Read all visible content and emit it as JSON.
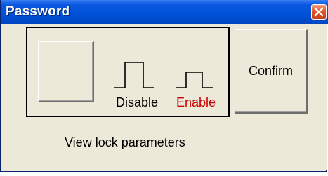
{
  "window": {
    "title": "Password"
  },
  "buttons": {
    "confirm_label": "Confirm"
  },
  "indicators": {
    "disable_label": "Disable",
    "enable_label": "Enable",
    "enable_color": "#cc0000"
  },
  "status": {
    "view_lock_text": "View lock parameters"
  },
  "icons": {
    "close": "close-icon",
    "disable": "pulse-high-icon",
    "enable": "pulse-low-icon"
  }
}
